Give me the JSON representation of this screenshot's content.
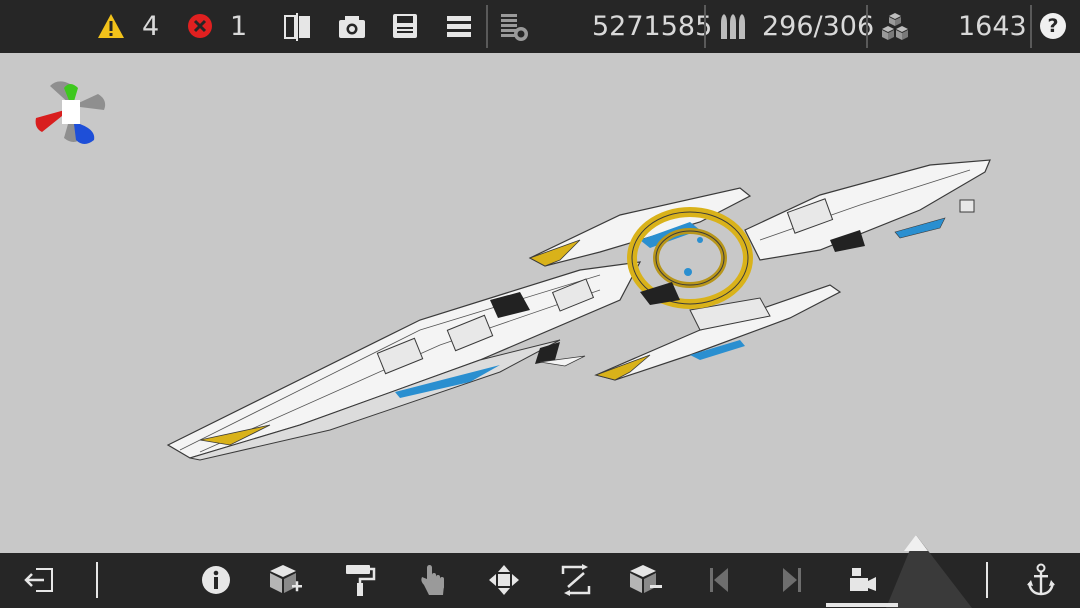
{
  "topbar": {
    "warnings_count": "4",
    "errors_count": "1",
    "block_count": "5271585",
    "weapons_count": "296/306",
    "parts_count": "1643",
    "help_label": "?"
  },
  "icons": {
    "warning": "warning-icon",
    "error": "error-icon",
    "symmetry": "symmetry-icon",
    "screenshot": "camera-icon",
    "save": "save-icon",
    "menu": "menu-icon",
    "blocks": "block-stack-icon",
    "weapons": "ammo-icon",
    "parts": "cubes-icon",
    "exit": "exit-icon",
    "info": "info-icon",
    "add_block": "add-block-icon",
    "paint": "paint-roller-icon",
    "select": "hand-pointer-icon",
    "move": "move-arrows-icon",
    "rotate": "rotate-icon",
    "remove_block": "remove-block-icon",
    "prev": "step-back-icon",
    "next": "step-forward-icon",
    "camera_mode": "camera-mode-icon",
    "anchor": "anchor-icon"
  },
  "colors": {
    "bar_bg": "#262626",
    "viewport_bg": "#c8c8c8",
    "warning": "#f2c21a",
    "error": "#e02020",
    "axis_x": "#d81e1e",
    "axis_y": "#3ec81e",
    "axis_z": "#1e4fd8",
    "ship_accent_gold": "#d9b21a",
    "ship_accent_blue": "#2a8fd0"
  }
}
